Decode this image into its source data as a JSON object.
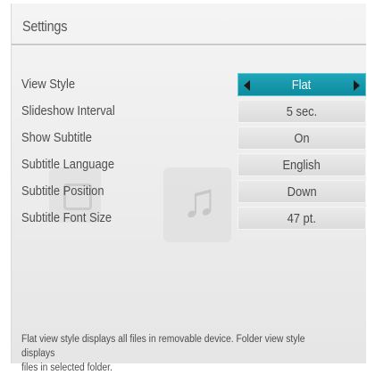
{
  "header": {
    "title": "Settings"
  },
  "settings": [
    {
      "label": "View Style",
      "value": "Flat",
      "selected": true
    },
    {
      "label": "Slideshow Interval",
      "value": "5 sec."
    },
    {
      "label": "Show Subtitle",
      "value": "On"
    },
    {
      "label": "Subtitle Language",
      "value": "English"
    },
    {
      "label": "Subtitle Position",
      "value": "Down"
    },
    {
      "label": "Subtitle Font Size",
      "value": "47 pt."
    }
  ],
  "help": {
    "line1": "Flat view style displays all files in removable device. Folder view style displays",
    "line2": "files in selected folder."
  },
  "icons": {
    "background_left": "photo-icon",
    "background_right": "music-note-icon",
    "option_left": "triangle-left-icon",
    "option_right": "triangle-right-icon"
  },
  "colors": {
    "highlight": "#1596aa",
    "text": "#4d4d4d",
    "panel": "#eeeeee"
  }
}
